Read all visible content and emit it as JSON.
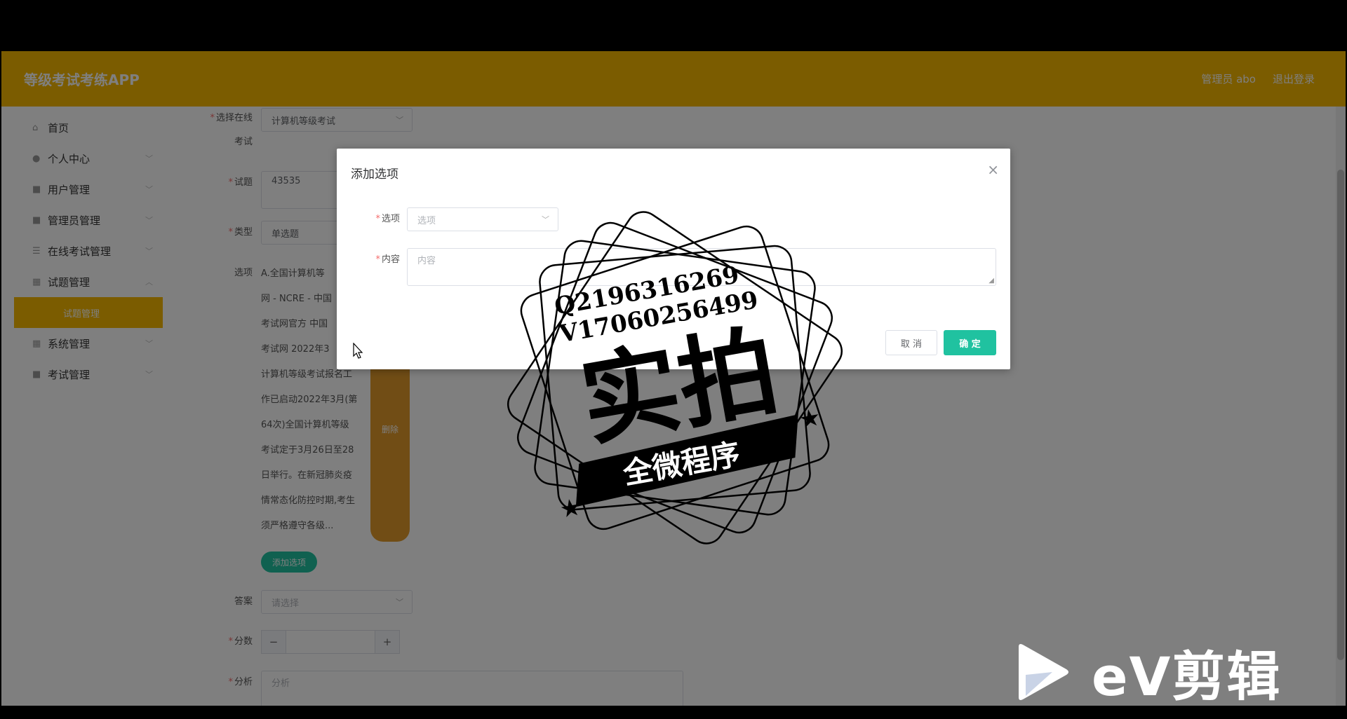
{
  "header": {
    "app_title": "等级考试考练APP",
    "user_label": "管理员 abo",
    "logout_label": "退出登录"
  },
  "sidebar": {
    "items": [
      {
        "label": "首页",
        "icon": "home-icon",
        "glyph": "⌂"
      },
      {
        "label": "个人中心",
        "icon": "user-icon",
        "glyph": "●"
      },
      {
        "label": "用户管理",
        "icon": "clipboard-icon",
        "glyph": "■"
      },
      {
        "label": "管理员管理",
        "icon": "clipboard-icon",
        "glyph": "■"
      },
      {
        "label": "在线考试管理",
        "icon": "list-icon",
        "glyph": "☰"
      },
      {
        "label": "试题管理",
        "icon": "grid-icon",
        "glyph": "▦"
      },
      {
        "label": "系统管理",
        "icon": "grid-icon",
        "glyph": "▦"
      },
      {
        "label": "考试管理",
        "icon": "clipboard-icon",
        "glyph": "■"
      }
    ],
    "active_sub": "试题管理"
  },
  "form": {
    "exam_label_1": "选择在线",
    "exam_label_2": "考试",
    "exam_value": "计算机等级考试",
    "question_label": "试题",
    "question_value": "43535",
    "type_label": "类型",
    "type_value": "单选题",
    "options_label": "选项",
    "option_lines": [
      "A.全国计算机等",
      "网 - NCRE - 中国",
      "考试网官方 中国",
      "考试网 2022年3",
      "计算机等级考试报名工",
      "作已启动2022年3月(第",
      "64次)全国计算机等级",
      "考试定于3月26日至28",
      "日举行。在新冠肺炎疫",
      "情常态化防控时期,考生",
      "须严格遵守各级..."
    ],
    "delete_label": "删除",
    "add_option_label": "添加选项",
    "answer_label": "答案",
    "answer_placeholder": "请选择",
    "score_label": "分数",
    "score_minus": "−",
    "score_plus": "+",
    "analysis_label": "分析",
    "analysis_placeholder": "分析"
  },
  "dialog": {
    "title": "添加选项",
    "close": "×",
    "option_label": "选项",
    "option_placeholder": "选项",
    "content_label": "内容",
    "content_placeholder": "内容",
    "cancel_label": "取 消",
    "ok_label": "确 定"
  },
  "watermark": {
    "line1": "Q2196316269",
    "line2": "V17060256499",
    "main": "实拍",
    "ribbon": "全微程序"
  },
  "ev_logo": {
    "text": "eV剪辑"
  },
  "colors": {
    "brand": "#f6b901",
    "accent": "#20c2a0",
    "danger": "#f56c6c"
  }
}
